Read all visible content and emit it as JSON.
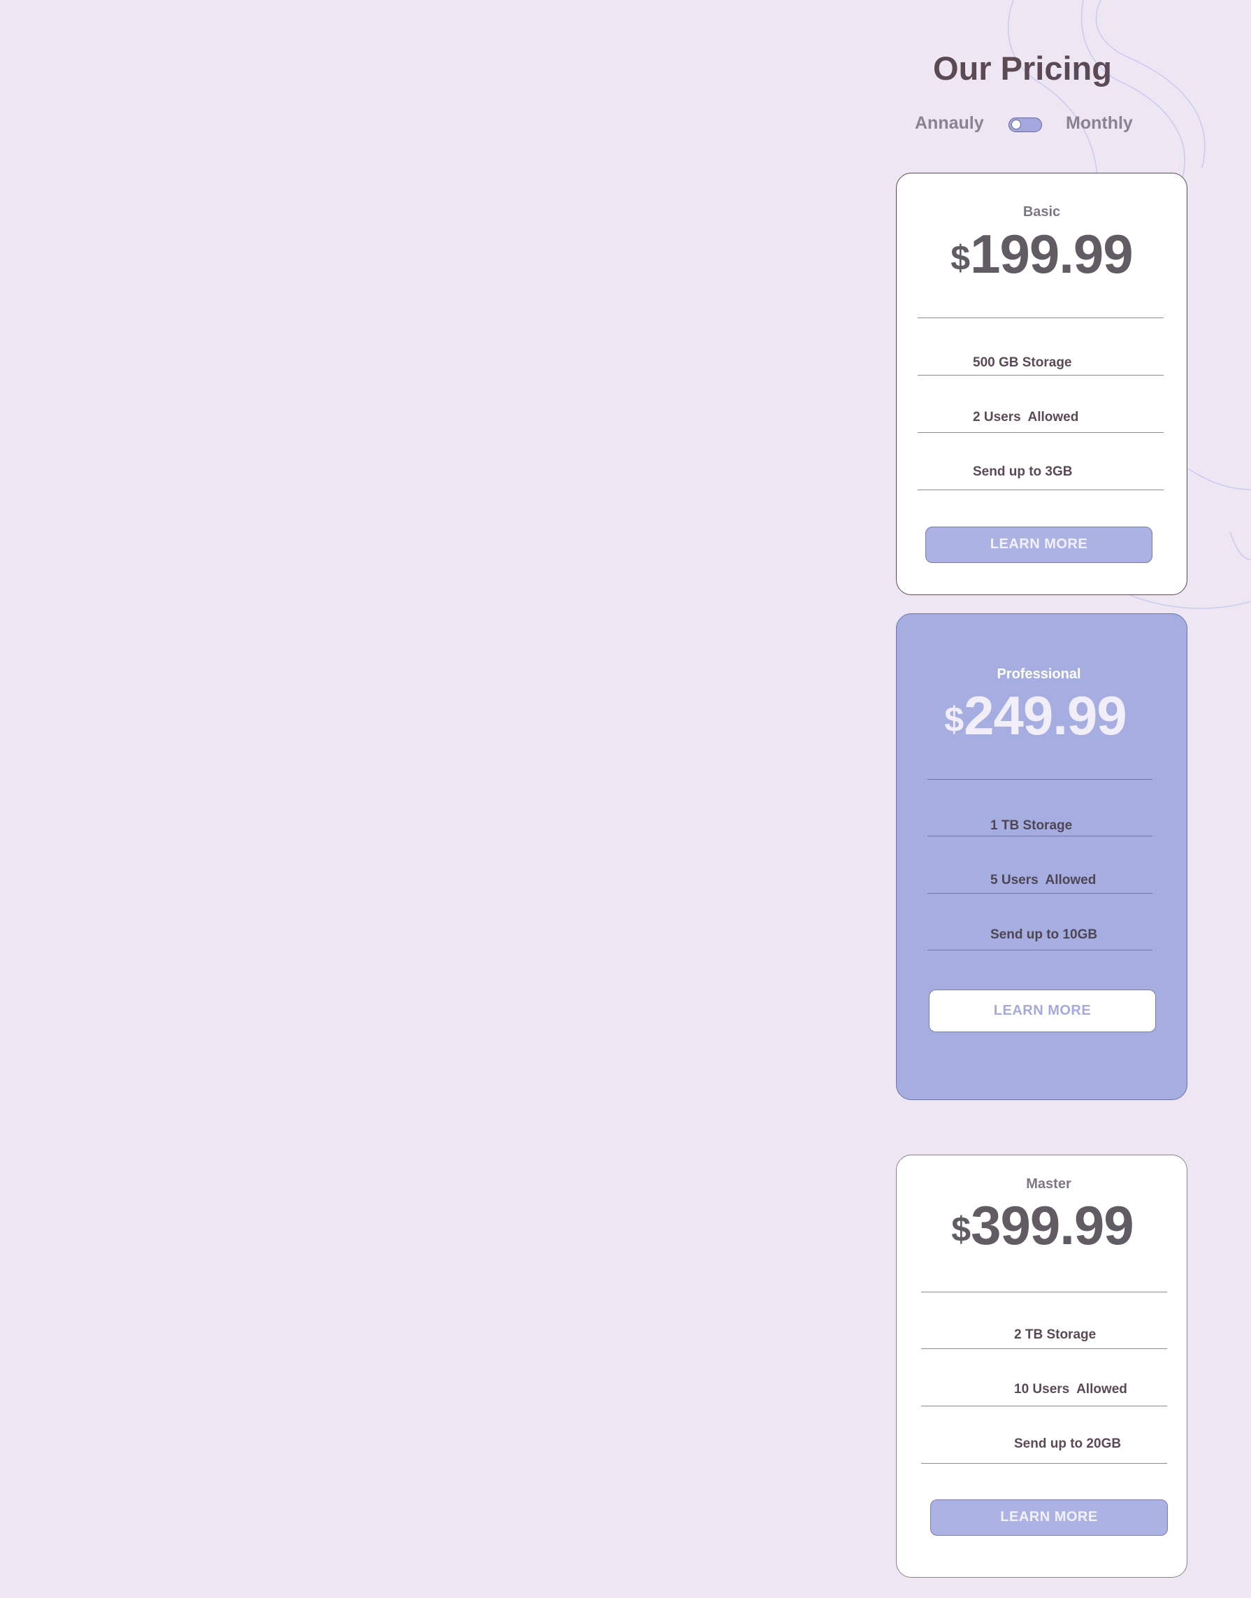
{
  "page": {
    "title": "Our Pricing"
  },
  "billing_toggle": {
    "left_label": "Annauly",
    "right_label": "Monthly"
  },
  "colors": {
    "background": "#eee6f3",
    "accent": "#a6ade1",
    "text": "#5b4a54",
    "button_fill": "#adb2e4"
  },
  "plans": [
    {
      "name": "Basic",
      "currency": "$",
      "price": "199.99",
      "features": [
        "500 GB Storage",
        "2 Users  Allowed",
        "Send up to 3GB"
      ],
      "button": "LEARN MORE"
    },
    {
      "name": "Professional",
      "currency": "$",
      "price": "249.99",
      "features": [
        "1 TB Storage",
        "5 Users  Allowed",
        "Send up to 10GB"
      ],
      "button": "LEARN MORE"
    },
    {
      "name": "Master",
      "currency": "$",
      "price": "399.99",
      "features": [
        "2 TB Storage",
        "10 Users  Allowed",
        "Send up to 20GB"
      ],
      "button": "LEARN MORE"
    }
  ]
}
